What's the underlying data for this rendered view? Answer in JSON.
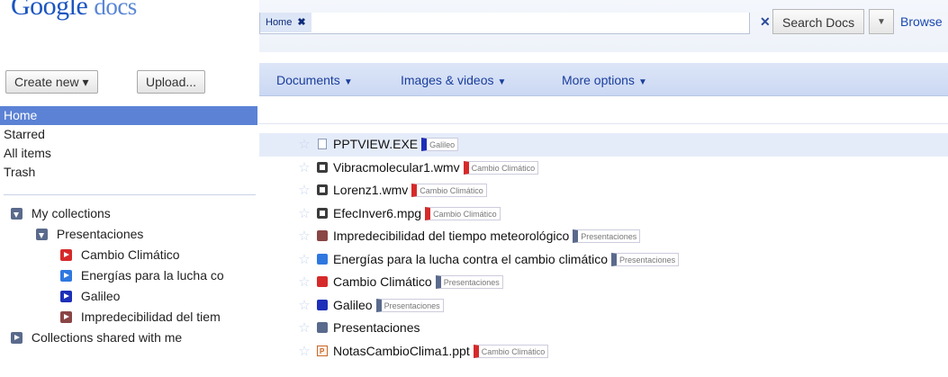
{
  "app": {
    "logo_google": "Google",
    "logo_docs": "docs"
  },
  "search": {
    "chip_label": "Home",
    "chip_close": "✖",
    "clear": "✕",
    "button_label": "Search Docs",
    "dropdown_glyph": "▼",
    "browse_label": "Browse"
  },
  "sidebar": {
    "create_new": "Create new ▾",
    "upload": "Upload...",
    "nav": [
      {
        "label": "Home",
        "active": true
      },
      {
        "label": "Starred",
        "active": false
      },
      {
        "label": "All items",
        "active": false
      },
      {
        "label": "Trash",
        "active": false
      }
    ],
    "collections": {
      "my_collections": "My collections",
      "presentaciones": "Presentaciones",
      "children": [
        {
          "label": "Cambio Climático",
          "color": "#d62a2a"
        },
        {
          "label": "Energías para la lucha co",
          "color": "#2f78e0"
        },
        {
          "label": "Galileo",
          "color": "#1d2fb8"
        },
        {
          "label": "Impredecibilidad del tiem",
          "color": "#8a4545"
        }
      ],
      "shared": "Collections shared with me"
    }
  },
  "toolbar": {
    "documents": "Documents",
    "images_videos": "Images & videos",
    "more_options": "More options",
    "caret": "▼"
  },
  "colors": {
    "galileo": "#1d2fb8",
    "cambio": "#d62a2a",
    "presentaciones": "#5a6a8c",
    "energias": "#2f78e0",
    "impredecibilidad": "#8a4545"
  },
  "documents": [
    {
      "name": "PPTVIEW.EXE",
      "icon": "page-icon",
      "tag": "Galileo",
      "tag_color": "#1d2fb8",
      "selected": true
    },
    {
      "name": "Vibracmolecular1.wmv",
      "icon": "video-icon",
      "tag": "Cambio Climático",
      "tag_color": "#d62a2a",
      "selected": false
    },
    {
      "name": "Lorenz1.wmv",
      "icon": "video-icon",
      "tag": "Cambio Climático",
      "tag_color": "#d62a2a",
      "selected": false
    },
    {
      "name": "EfecInver6.mpg",
      "icon": "video-icon",
      "tag": "Cambio Climático",
      "tag_color": "#d62a2a",
      "selected": false
    },
    {
      "name": "Impredecibilidad del tiempo meteorológico",
      "icon": "folder-icon",
      "folder_color": "#8a4545",
      "tag": "Presentaciones",
      "tag_color": "#5a6a8c",
      "selected": false
    },
    {
      "name": "Energías para la lucha contra el cambio climático",
      "icon": "folder-icon",
      "folder_color": "#2f78e0",
      "tag": "Presentaciones",
      "tag_color": "#5a6a8c",
      "selected": false
    },
    {
      "name": "Cambio Climático",
      "icon": "folder-icon",
      "folder_color": "#d62a2a",
      "tag": "Presentaciones",
      "tag_color": "#5a6a8c",
      "selected": false
    },
    {
      "name": "Galileo",
      "icon": "folder-icon",
      "folder_color": "#1d2fb8",
      "tag": "Presentaciones",
      "tag_color": "#5a6a8c",
      "selected": false
    },
    {
      "name": "Presentaciones",
      "icon": "folder-icon",
      "folder_color": "#5a6a8c",
      "tag": "",
      "tag_color": "",
      "selected": false
    },
    {
      "name": "NotasCambioClima1.ppt",
      "icon": "ppt-icon",
      "tag": "Cambio Climático",
      "tag_color": "#d62a2a",
      "selected": false
    }
  ]
}
